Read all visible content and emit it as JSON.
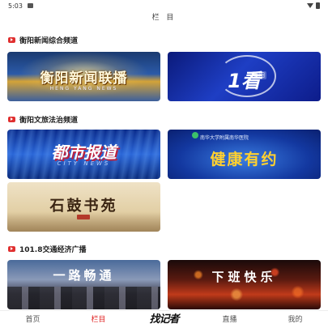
{
  "status_bar": {
    "time": "5:03"
  },
  "header": {
    "title": "栏 目"
  },
  "sections": [
    {
      "title": "衡阳新闻综合频道",
      "cards": [
        {
          "caption": "衡阳新闻联播",
          "sub": "HENG YANG NEWS"
        },
        {
          "caption": "1看",
          "tag": "衡阳"
        }
      ]
    },
    {
      "title": "衡阳文旅法治频道",
      "cards": [
        {
          "caption": "都市报道",
          "sub": "CITY NEWS"
        },
        {
          "caption": "健康有约",
          "top": "南华大学附属南华医院"
        },
        {
          "caption": "石鼓书苑"
        }
      ]
    },
    {
      "title": "101.8交通经济广播",
      "cards": [
        {
          "caption": "一路畅通"
        },
        {
          "caption": "下班快乐"
        }
      ]
    }
  ],
  "bottom_nav": [
    {
      "label": "首页",
      "active": false
    },
    {
      "label": "栏目",
      "active": true
    },
    {
      "label": "找记者",
      "active": false
    },
    {
      "label": "直播",
      "active": false
    },
    {
      "label": "我的",
      "active": false
    }
  ],
  "colors": {
    "accent": "#e02424"
  }
}
